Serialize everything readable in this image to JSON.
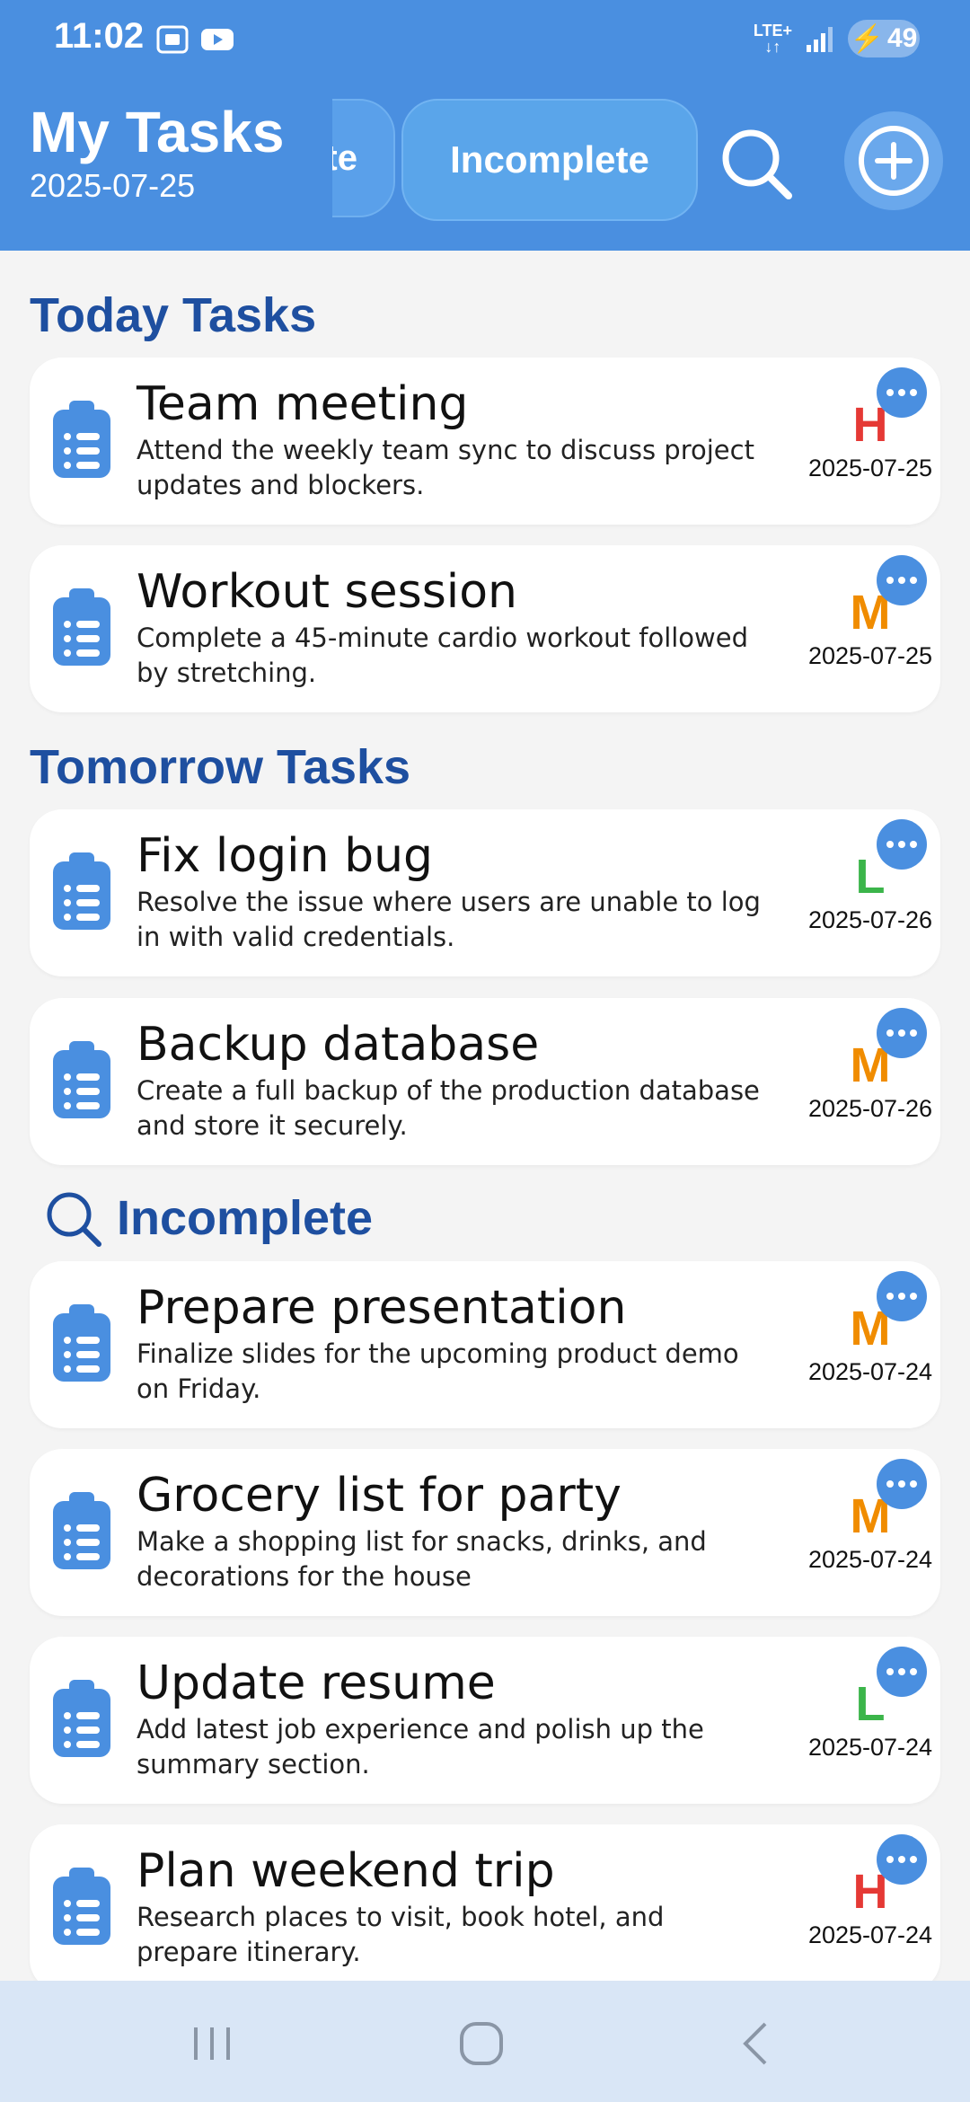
{
  "status_bar": {
    "time": "11:02",
    "network": "LTE+",
    "battery": "49"
  },
  "header": {
    "title": "My Tasks",
    "date": "2025-07-25",
    "tab_prev_label": "Complete",
    "tab_active_label": "Incomplete"
  },
  "sections": {
    "today": "Today Tasks",
    "tomorrow": "Tomorrow Tasks",
    "incomplete": "Incomplete"
  },
  "colors": {
    "high": "#e53935",
    "medium": "#f08c00",
    "low": "#3bb54a",
    "accent": "#4a8fe0"
  },
  "tasks": [
    {
      "title": "Team meeting",
      "desc": "Attend the weekly team sync to discuss project updates and blockers.",
      "priority": "H",
      "date": "2025-07-25"
    },
    {
      "title": "Workout session",
      "desc": "Complete a 45-minute cardio workout followed by stretching.",
      "priority": "M",
      "date": "2025-07-25"
    },
    {
      "title": "Fix login bug",
      "desc": "Resolve the issue where users are unable to log in with valid credentials.",
      "priority": "L",
      "date": "2025-07-26"
    },
    {
      "title": "Backup database",
      "desc": "Create a full backup of the production database and store it securely.",
      "priority": "M",
      "date": "2025-07-26"
    },
    {
      "title": "Prepare presentation",
      "desc": "Finalize slides for the upcoming product demo on Friday.",
      "priority": "M",
      "date": "2025-07-24"
    },
    {
      "title": "Grocery list for party",
      "desc": "Make a shopping list for snacks, drinks, and decorations for the house",
      "priority": "M",
      "date": "2025-07-24"
    },
    {
      "title": "Update resume",
      "desc": "Add latest job experience and polish up the summary section.",
      "priority": "L",
      "date": "2025-07-24"
    },
    {
      "title": "Plan weekend trip",
      "desc": "Research places to visit, book hotel, and prepare itinerary.",
      "priority": "H",
      "date": "2025-07-24"
    }
  ]
}
